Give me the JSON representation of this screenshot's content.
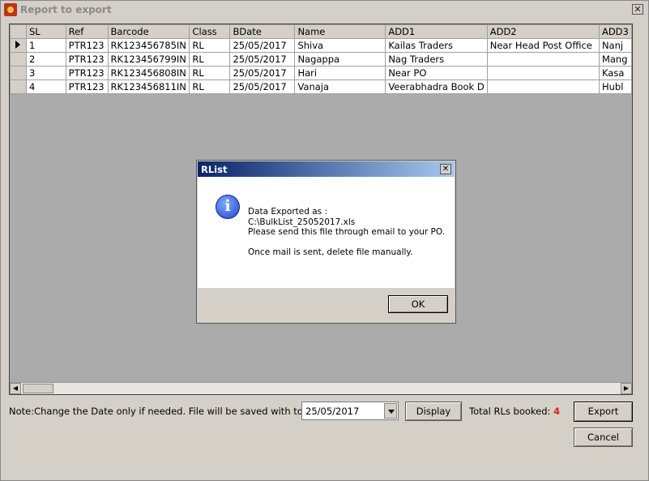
{
  "window": {
    "title": "Report to export",
    "close_glyph": "✕"
  },
  "grid": {
    "columns": [
      "SL",
      "Ref",
      "Barcode",
      "Class",
      "BDate",
      "Name",
      "ADD1",
      "ADD2",
      "ADD3"
    ],
    "rows": [
      [
        "1",
        "PTR123",
        "RK123456785IN",
        "RL",
        "25/05/2017",
        "Shiva",
        "Kailas Traders",
        "Near Head Post Office",
        "Nanj"
      ],
      [
        "2",
        "PTR123",
        "RK123456799IN",
        "RL",
        "25/05/2017",
        "Nagappa",
        "Nag Traders",
        "",
        "Mang"
      ],
      [
        "3",
        "PTR123",
        "RK123456808IN",
        "RL",
        "25/05/2017",
        "Hari",
        "Near PO",
        "",
        "Kasa"
      ],
      [
        "4",
        "PTR123",
        "RK123456811IN",
        "RL",
        "25/05/2017",
        "Vanaja",
        "Veerabhadra Book D",
        "",
        "Hubl"
      ]
    ]
  },
  "footer": {
    "note": "Note:Change the Date only if needed. File will be saved with today's date.",
    "date_value": "25/05/2017",
    "display_label": "Display",
    "total_label": "Total RLs booked:",
    "total_count": "4",
    "export_label": "Export",
    "cancel_label": "Cancel"
  },
  "dialog": {
    "title": "RList",
    "close_glyph": "✕",
    "icon": "info-icon",
    "lines": [
      "Data Exported as :",
      "C:\\BulkList_25052017.xls",
      "Please send this file through email to your PO.",
      "",
      "Once mail is sent, delete file manually."
    ],
    "ok_label": "OK"
  }
}
